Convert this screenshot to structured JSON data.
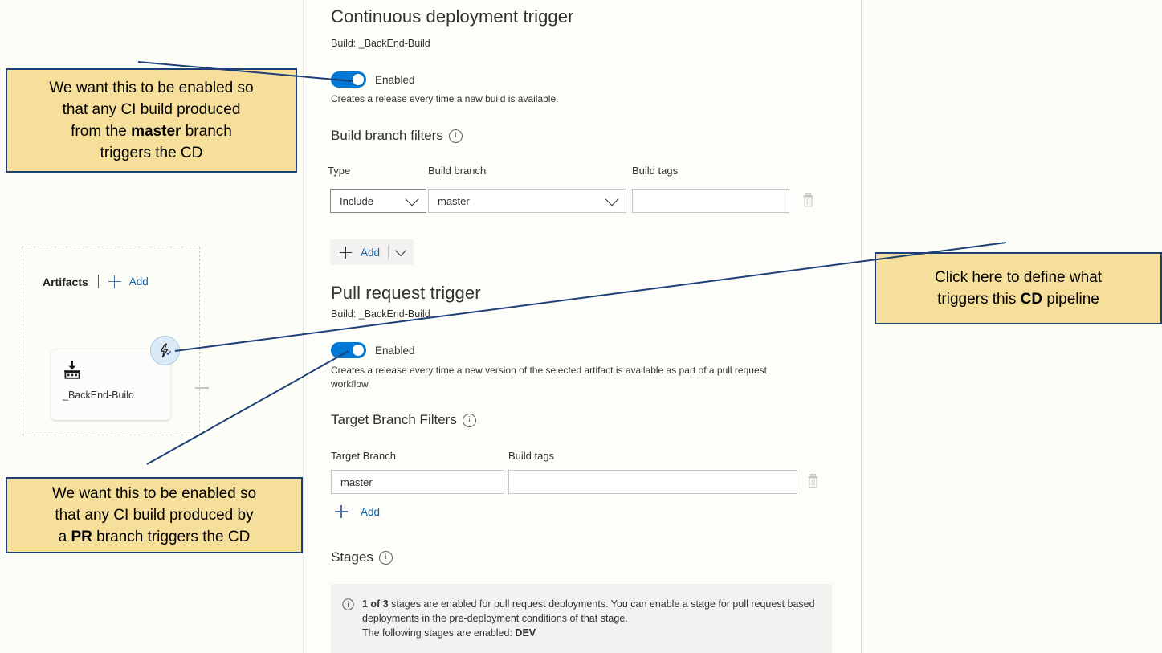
{
  "panel": {
    "cd": {
      "title": "Continuous deployment trigger",
      "subtitle": "Build: _BackEnd-Build",
      "toggle_label": "Enabled",
      "hint": "Creates a release every time a new build is available.",
      "filters_title": "Build branch filters",
      "columns": {
        "type": "Type",
        "branch": "Build branch",
        "tags": "Build tags"
      },
      "row": {
        "type_value": "Include",
        "branch_value": "master",
        "tags_value": ""
      },
      "add_label": "Add"
    },
    "pr": {
      "title": "Pull request trigger",
      "subtitle": "Build: _BackEnd-Build",
      "toggle_label": "Enabled",
      "hint": "Creates a release every time a new version of the selected artifact is available as part of a pull request workflow",
      "filters_title": "Target Branch Filters",
      "columns": {
        "branch": "Target Branch",
        "tags": "Build tags"
      },
      "row": {
        "branch_value": "master",
        "tags_value": ""
      },
      "add_label": "Add"
    },
    "stages": {
      "title": "Stages",
      "banner_count": "1 of 3",
      "banner_text": " stages are enabled for pull request deployments. You can enable a stage for pull request based deployments in the pre-deployment conditions of that stage.",
      "banner_line2_prefix": "The following stages are enabled:",
      "banner_stage": "DEV"
    }
  },
  "artifacts": {
    "title": "Artifacts",
    "add_label": "Add",
    "card_name": "_BackEnd-Build"
  },
  "callouts": {
    "cd_line1": "We want this to be enabled so",
    "cd_line2": "that any CI build produced",
    "cd_line3_pre": "from the ",
    "cd_line3_bold": "master",
    "cd_line3_post": " branch",
    "cd_line4": "triggers the CD",
    "pr_line1": "We want this to be enabled so",
    "pr_line2": "that any CI build produced by",
    "pr_line3_pre": "a ",
    "pr_line3_bold": "PR",
    "pr_line3_post": " branch triggers the CD",
    "click_line1": "Click here to define what",
    "click_line2_pre": "triggers this ",
    "click_line2_bold": "CD",
    "click_line2_post": " pipeline"
  },
  "colors": {
    "accent": "#0078d4",
    "link": "#0d5fa9",
    "callout_fill": "#f6df9b",
    "callout_border": "#1f3f77",
    "arrow": "#1f3f77"
  }
}
